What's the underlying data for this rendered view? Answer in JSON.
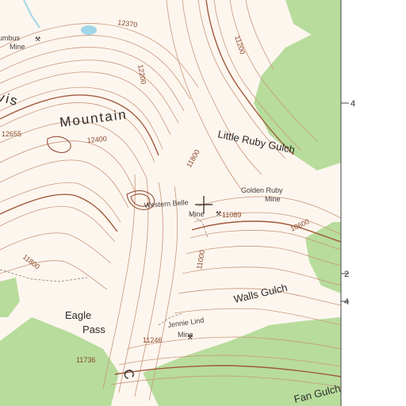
{
  "colors": {
    "background": "#fdf6ef",
    "forest": "#b7dc9c",
    "contour": "#c9967a",
    "index_contour": "#a05a3a",
    "water": "#9fd7e8",
    "margin": "#ffffff"
  },
  "labels": {
    "mountain": "Mountain",
    "mountain_partial": "vis",
    "little_ruby_gulch": "Little Ruby Gulch",
    "walls_gulch": "Walls Gulch",
    "eagle_pass_1": "Eagle",
    "eagle_pass_2": "Pass",
    "fan_gulch": "Fan Gulch",
    "partial_c": "C"
  },
  "mines": {
    "columbus_1": "umbus",
    "columbus_2": "Mine",
    "golden_ruby_1": "Golden Ruby",
    "golden_ruby_2": "Mine",
    "western_belle_1": "Western Belle",
    "western_belle_2": "Mine",
    "jennie_lind_1": "Jennie Lind",
    "jennie_lind_2": "Mine"
  },
  "elevations": {
    "e12370": "12370",
    "e12400": "12400",
    "e12655": "12655",
    "e12200": "12200",
    "e11800a": "11800",
    "e11800b": "11800",
    "e11200": "11200",
    "e11089": "11089",
    "e11000": "11000",
    "e10600": "10600",
    "e11246": "11246",
    "e11736": "11736"
  },
  "margin_ticks": {
    "t1": "4",
    "t2": "2",
    "t3": "4"
  },
  "features": {
    "crosshair_icon": "crosshair-icon",
    "mine_symbol": "mine-symbol-icon"
  }
}
